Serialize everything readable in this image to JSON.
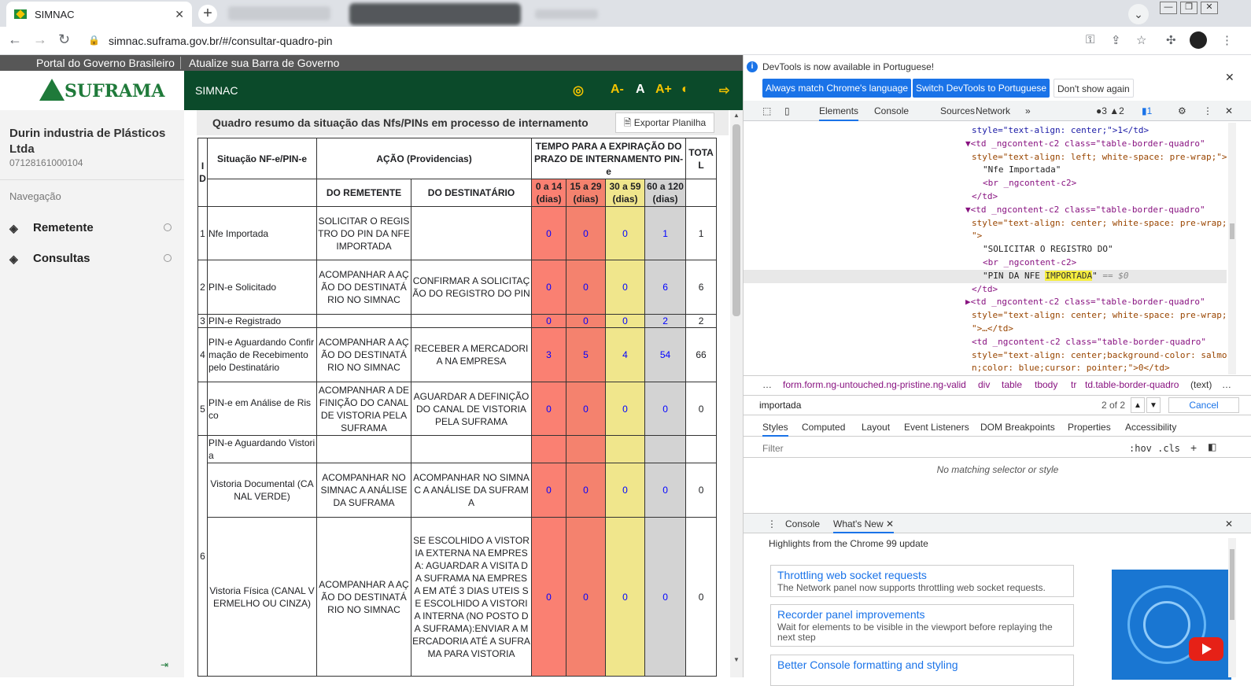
{
  "browser": {
    "tab_title": "SIMNAC",
    "tab_close": "✕",
    "new_tab": "+",
    "url": "simnac.suframa.gov.br/#/consultar-quadro-pin",
    "icons": [
      "back-icon",
      "forward-icon",
      "reload-icon",
      "lock-icon",
      "key-icon",
      "share-icon",
      "star-icon",
      "extensions-icon",
      "profile-avatar"
    ]
  },
  "govbar": {
    "portal": "Portal do Governo Brasileiro",
    "update": "Atualize sua Barra de Governo"
  },
  "sidebar": {
    "logo_text": "SUFRAMA",
    "company": "Durin industria de Plásticos Ltda",
    "cnpj": "07128161000104",
    "nav_label": "Navegação",
    "items": [
      {
        "label": "Remetente"
      },
      {
        "label": "Consultas"
      }
    ]
  },
  "header": {
    "app_name": "SIMNAC",
    "font_dec": "A-",
    "font_reset": "A",
    "font_inc": "A+"
  },
  "panel": {
    "title": "Quadro resumo da situação das Nfs/PINs em processo de internamento",
    "export_label": "Exportar Planilha"
  },
  "table": {
    "headers": {
      "id": "ID",
      "situacao": "Situação NF-e/PIN-e",
      "acao": "AÇÃO (Providencias)",
      "tempo": "TEMPO PARA A EXPIRAÇÃO DO PRAZO DE INTERNAMENTO PIN-e",
      "total": "TOTAL",
      "remetente": "DO REMETENTE",
      "destinatario": "DO DESTINATÁRIO",
      "r1": "0 a 14 (dias)",
      "r2": "15 a 29 (dias)",
      "r3": "30 a 59 (dias)",
      "r4": "60 a 120 (dias)"
    },
    "rows": [
      {
        "id": "1",
        "sit": "Nfe Importada",
        "rem": "SOLICITAR O REGISTRO DO PIN DA NFE IMPORTADA",
        "dest": "",
        "v1": "0",
        "v2": "0",
        "v3": "0",
        "v4": "1",
        "total": "1"
      },
      {
        "id": "2",
        "sit": "PIN-e Solicitado",
        "rem": "ACOMPANHAR A AÇÃO DO DESTINATÁRIO NO SIMNAC",
        "dest": "CONFIRMAR A SOLICITAÇÃO DO REGISTRO DO PIN",
        "v1": "0",
        "v2": "0",
        "v3": "0",
        "v4": "6",
        "total": "6"
      },
      {
        "id": "3",
        "sit": "PIN-e Registrado",
        "rem": "",
        "dest": "",
        "v1": "0",
        "v2": "0",
        "v3": "0",
        "v4": "2",
        "total": "2"
      },
      {
        "id": "4",
        "sit": "PIN-e Aguardando Confirmação de Recebimento pelo Destinatário",
        "rem": "ACOMPANHAR A AÇÃO DO DESTINATÁRIO NO SIMNAC",
        "dest": "RECEBER A MERCADORIA NA EMPRESA",
        "v1": "3",
        "v2": "5",
        "v3": "4",
        "v4": "54",
        "total": "66"
      },
      {
        "id": "5",
        "sit": "PIN-e em Análise de Risco",
        "rem": "ACOMPANHAR A DEFINIÇÃO DO CANAL DE VISTORIA PELA SUFRAMA",
        "dest": "AGUARDAR A DEFINIÇÃO DO CANAL DE VISTORIA PELA SUFRAMA",
        "v1": "0",
        "v2": "0",
        "v3": "0",
        "v4": "0",
        "total": "0"
      },
      {
        "id": "6",
        "sit": "PIN-e Aguardando Vistoria"
      },
      {
        "sit": "Vistoria Documental (CANAL VERDE)",
        "rem": "ACOMPANHAR NO SIMNAC A ANÁLISE DA SUFRAMA",
        "dest": "ACOMPANHAR NO SIMNAC A ANÁLISE DA SUFRAMA",
        "v1": "0",
        "v2": "0",
        "v3": "0",
        "v4": "0",
        "total": "0"
      },
      {
        "sit": "Vistoria Física (CANAL VERMELHO OU CINZA)",
        "rem": "ACOMPANHAR A AÇÃO DO DESTINATÁRIO NO SIMNAC",
        "dest": "SE ESCOLHIDO A VISTORIA EXTERNA NA EMPRESA: AGUARDAR A VISITA DA SUFRAMA NA EMPRESA EM ATÉ 3 DIAS UTEIS SE ESCOLHIDO A VISTORIA INTERNA (NO POSTO DA SUFRAMA):ENVIAR A MERCADORIA ATÉ A SUFRAMA PARA VISTORIA",
        "v1": "0",
        "v2": "0",
        "v3": "0",
        "v4": "0",
        "total": "0"
      }
    ]
  },
  "devtools": {
    "info": "DevTools is now available in Portuguese!",
    "btn_match": "Always match Chrome's language",
    "btn_switch": "Switch DevTools to Portuguese",
    "btn_dont": "Don't show again",
    "tabs": [
      "Elements",
      "Console",
      "Sources",
      "Network",
      "»"
    ],
    "badges": "●3 ▲2",
    "msg_badge": "▮1",
    "code": {
      "l1": "style=\"text-align: center;\">1</td>",
      "l2a": "▼<td _ngcontent-c2 class=\"table-border-quadro\"",
      "l2b": "style=\"text-align: left; white-space: pre-wrap;\">",
      "l3": "\"Nfe Importada\"",
      "l4": "<br _ngcontent-c2>",
      "l5": "</td>",
      "l6a": "▼<td _ngcontent-c2 class=\"table-border-quadro\"",
      "l6b": "style=\"text-align: center; white-space: pre-wrap;",
      "l6c": "\">",
      "l7": "\"SOLICITAR O REGISTRO DO\"",
      "l8": "<br _ngcontent-c2>",
      "l9a": "\"PIN DA NFE ",
      "l9hl": "IMPORTADA",
      "l9b": "\"",
      "l9c": " == $0",
      "l10": "</td>",
      "l11a": "▶<td _ngcontent-c2 class=\"table-border-quadro\"",
      "l11b": "style=\"text-align: center; white-space: pre-wrap;",
      "l11c": "\">…</td>",
      "l12a": "<td _ngcontent-c2 class=\"table-border-quadro\"",
      "l12b": "style=\"text-align: center;background-color: salmo",
      "l12c": "n;color: blue;cursor: pointer;\">0</td>"
    },
    "crumbs": [
      "…",
      "form.form.ng-untouched.ng-pristine.ng-valid",
      "div",
      "table",
      "tbody",
      "tr",
      "td.table-border-quadro",
      "(text)",
      "…"
    ],
    "search_value": "importada",
    "search_count": "2 of 2",
    "cancel": "Cancel",
    "style_tabs": [
      "Styles",
      "Computed",
      "Layout",
      "Event Listeners",
      "DOM Breakpoints",
      "Properties",
      "Accessibility"
    ],
    "filter_placeholder": "Filter",
    "hov": ":hov  .cls",
    "no_match": "No matching selector or style",
    "drawer_tabs": [
      "Console",
      "What's New"
    ],
    "highlights": "Highlights from the Chrome 99 update",
    "cards": [
      {
        "title": "Throttling web socket requests",
        "desc": "The Network panel now supports throttling web socket requests."
      },
      {
        "title": "Recorder panel improvements",
        "desc": "Wait for elements to be visible in the viewport before replaying the next step"
      },
      {
        "title": "Better Console formatting and styling",
        "desc": ""
      }
    ]
  }
}
